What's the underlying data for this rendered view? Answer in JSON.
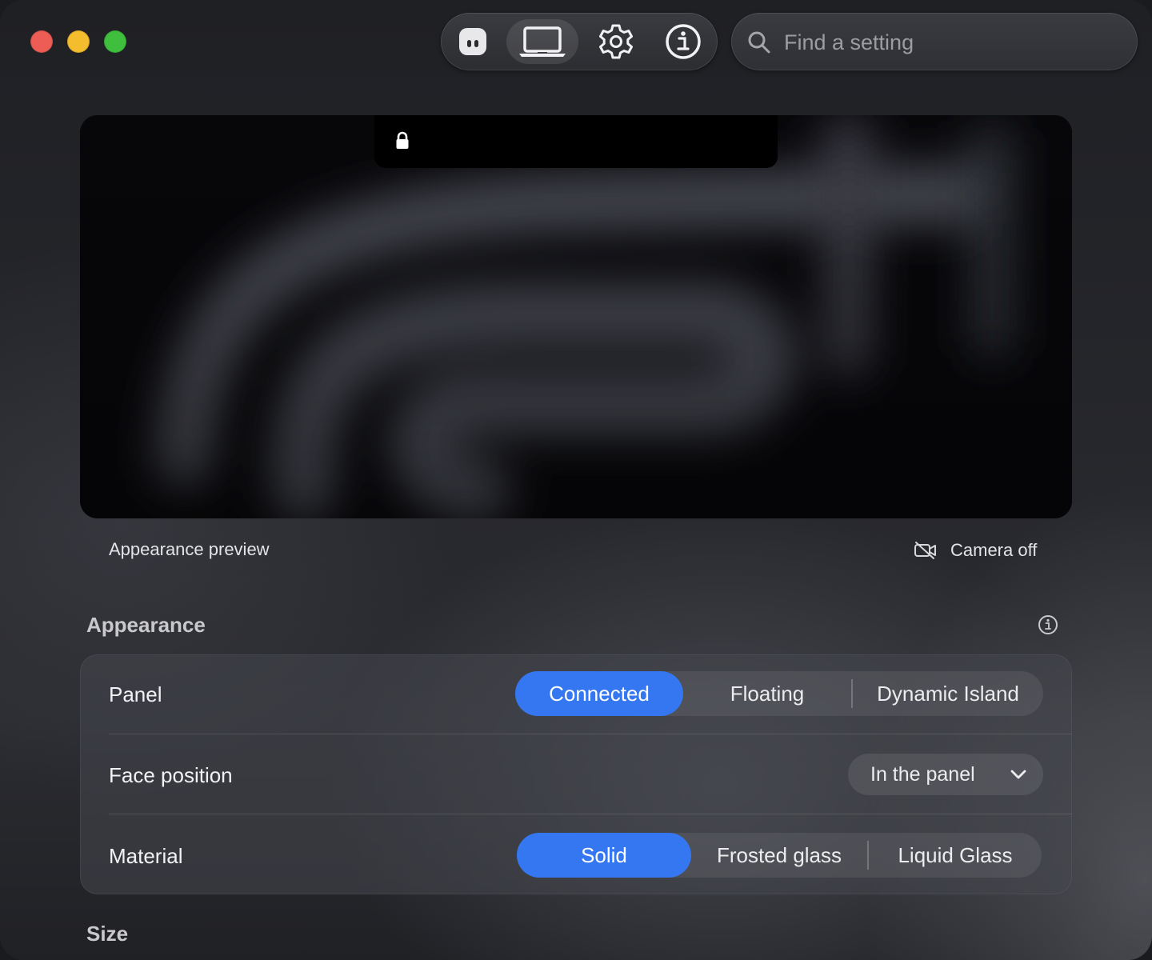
{
  "window": {
    "colors": {
      "close": "#ed5d56",
      "minimize": "#f3bd2e",
      "zoom": "#3fbf3d",
      "accent": "#3477f1"
    }
  },
  "toolbar": {
    "items": [
      {
        "icon": "app-face-icon",
        "active": false
      },
      {
        "icon": "laptop-icon",
        "active": true
      },
      {
        "icon": "gear-icon",
        "active": false
      },
      {
        "icon": "info-icon",
        "active": false
      }
    ]
  },
  "search": {
    "placeholder": "Find a setting",
    "value": ""
  },
  "preview": {
    "caption": "Appearance preview",
    "camera_label": "Camera off",
    "notch_icon": "lock-icon",
    "camera_icon": "video-off-icon"
  },
  "appearance": {
    "title": "Appearance",
    "rows": {
      "panel": {
        "label": "Panel",
        "options": [
          "Connected",
          "Floating",
          "Dynamic Island"
        ],
        "selected": "Connected"
      },
      "face_position": {
        "label": "Face position",
        "value": "In the panel"
      },
      "material": {
        "label": "Material",
        "options": [
          "Solid",
          "Frosted glass",
          "Liquid Glass"
        ],
        "selected": "Solid"
      }
    }
  },
  "size": {
    "title": "Size"
  }
}
